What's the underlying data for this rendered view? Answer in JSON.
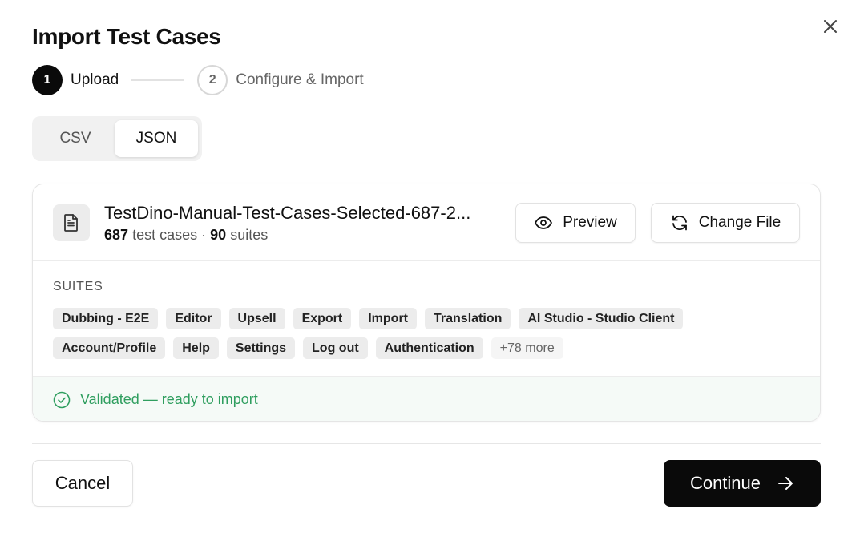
{
  "dialog": {
    "title": "Import Test Cases",
    "close_icon": "close-icon"
  },
  "steps": [
    {
      "number": "1",
      "label": "Upload",
      "state": "active"
    },
    {
      "number": "2",
      "label": "Configure & Import",
      "state": "inactive"
    }
  ],
  "format_tabs": {
    "items": [
      "CSV",
      "JSON"
    ],
    "selected": "JSON"
  },
  "file": {
    "icon": "file-text-icon",
    "name": "TestDino-Manual-Test-Cases-Selected-687-2...",
    "test_case_count": "687",
    "test_case_label": "test cases",
    "separator": "·",
    "suite_count": "90",
    "suite_label": "suites",
    "preview_label": "Preview",
    "preview_icon": "eye-icon",
    "change_label": "Change File",
    "change_icon": "refresh-icon"
  },
  "suites": {
    "title": "SUITES",
    "row1": [
      "Dubbing - E2E",
      "Editor",
      "Upsell",
      "Export",
      "Import",
      "Translation",
      "AI Studio - Studio Client"
    ],
    "row2": [
      "Account/Profile",
      "Help",
      "Settings",
      "Log out",
      "Authentication"
    ],
    "more": "+78 more"
  },
  "status": {
    "icon": "check-circle-icon",
    "text": "Validated — ready to import",
    "color": "#2f9e5f"
  },
  "footer": {
    "cancel_label": "Cancel",
    "continue_label": "Continue",
    "continue_icon": "arrow-right-icon"
  },
  "colors": {
    "primary": "#0a0a0a",
    "success": "#2f9e5f"
  }
}
